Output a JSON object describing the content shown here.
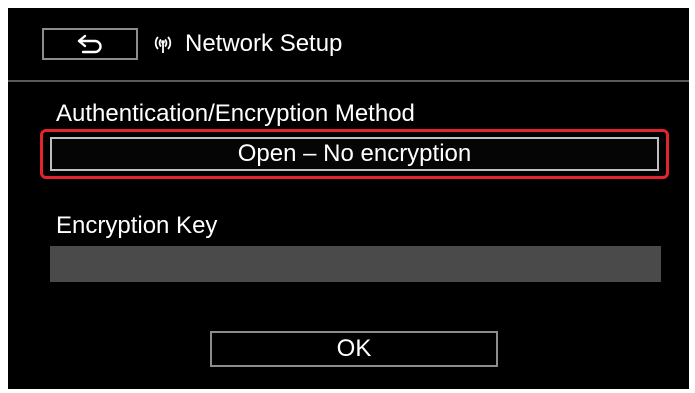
{
  "header": {
    "back_icon": "return-arrow-icon",
    "wifi_icon": "wireless-signal-icon",
    "title": "Network Setup"
  },
  "auth": {
    "label": "Authentication/Encryption Method",
    "value": "Open – No encryption",
    "highlight_color": "#e3232e"
  },
  "key": {
    "label": "Encryption Key",
    "value": ""
  },
  "ok_label": "OK"
}
